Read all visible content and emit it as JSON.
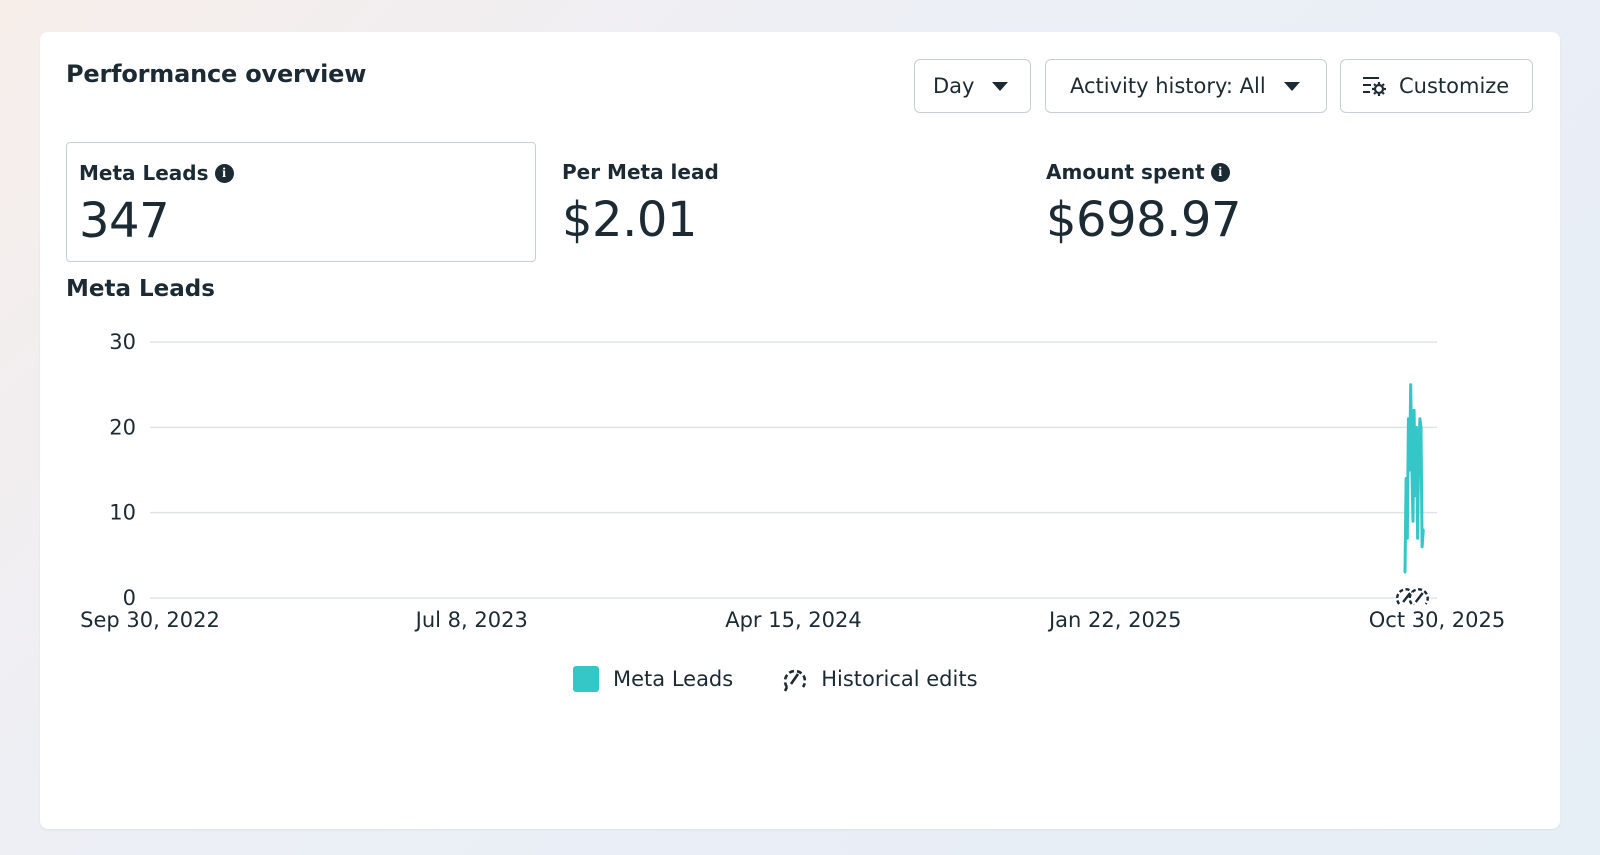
{
  "card": {
    "title": "Performance overview"
  },
  "toolbar": {
    "day_label": "Day",
    "activity_label": "Activity history: All",
    "customize_label": "Customize"
  },
  "metrics": [
    {
      "label": "Meta Leads",
      "value": "347",
      "info": true,
      "selected": true
    },
    {
      "label": "Per Meta lead",
      "value": "$2.01",
      "info": false,
      "selected": false
    },
    {
      "label": "Amount spent",
      "value": "$698.97",
      "info": true,
      "selected": false
    }
  ],
  "chart_title": "Meta Leads",
  "legend": {
    "series_label": "Meta Leads",
    "edits_label": "Historical edits"
  },
  "colors": {
    "series": "#35c6c8",
    "grid": "#dfe3e8",
    "text": "#1c2b33"
  },
  "chart_data": {
    "type": "line",
    "title": "Meta Leads",
    "xlabel": "",
    "ylabel": "",
    "ylim": [
      0,
      30
    ],
    "yticks": [
      0,
      10,
      20,
      30
    ],
    "xticks": [
      "Sep 30, 2022",
      "Jul 8, 2023",
      "Apr 15, 2024",
      "Jan 22, 2025",
      "Oct 30, 2025"
    ],
    "xrange": [
      "2022-09-30",
      "2025-10-30"
    ],
    "grid": true,
    "legend_position": "bottom",
    "series": [
      {
        "name": "Meta Leads",
        "color": "#35c6c8",
        "points": [
          {
            "x": "2025-10-02",
            "y": 3
          },
          {
            "x": "2025-10-03",
            "y": 14
          },
          {
            "x": "2025-10-04",
            "y": 7
          },
          {
            "x": "2025-10-05",
            "y": 21
          },
          {
            "x": "2025-10-06",
            "y": 15
          },
          {
            "x": "2025-10-07",
            "y": 25
          },
          {
            "x": "2025-10-08",
            "y": 15
          },
          {
            "x": "2025-10-09",
            "y": 9
          },
          {
            "x": "2025-10-10",
            "y": 22
          },
          {
            "x": "2025-10-11",
            "y": 12
          },
          {
            "x": "2025-10-12",
            "y": 20
          },
          {
            "x": "2025-10-13",
            "y": 7
          },
          {
            "x": "2025-10-14",
            "y": 17
          },
          {
            "x": "2025-10-15",
            "y": 21
          },
          {
            "x": "2025-10-16",
            "y": 20
          },
          {
            "x": "2025-10-17",
            "y": 6
          },
          {
            "x": "2025-10-18",
            "y": 8
          }
        ]
      }
    ],
    "historical_edits": [
      "2025-10-03",
      "2025-10-14"
    ]
  }
}
